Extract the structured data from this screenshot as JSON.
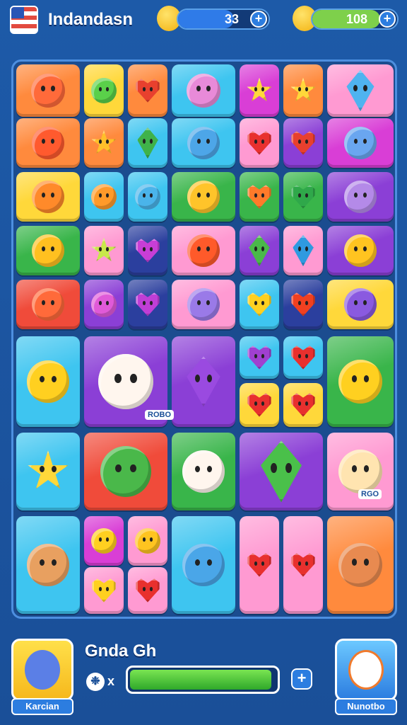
{
  "header": {
    "title": "Indandasn",
    "flag_icon": "flag-icon",
    "currencies": [
      {
        "value": "33",
        "icon": "bird-icon",
        "fill_fraction": 0.62,
        "color": "#2f7be8"
      },
      {
        "value": "108",
        "icon": "bird-icon",
        "fill_fraction": 0.8,
        "color": "#7ed04b"
      }
    ]
  },
  "board": {
    "chips": [
      "ROBO",
      "RGO"
    ],
    "colors": {
      "orange": "#ff8a3d",
      "yellow": "#ffd83a",
      "cyan": "#3ec5f0",
      "magenta": "#d93ed6",
      "green": "#39b54a",
      "purple": "#8b3fd6",
      "red": "#f04b3a",
      "pink": "#ff9ad2",
      "navy": "#2b3f9e"
    }
  },
  "footer": {
    "player_name": "Gnda Gh",
    "left_avatar_label": "Karcian",
    "right_avatar_label": "Nunotbo",
    "round_icon_text": "❉",
    "multiplier_symbol": "x",
    "progress_fraction": 0.97,
    "plus_label": "+"
  }
}
